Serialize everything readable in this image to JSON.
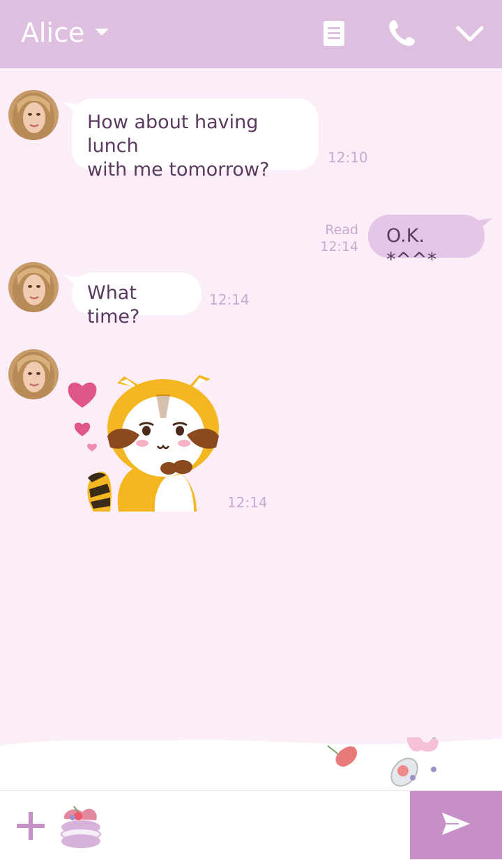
{
  "header": {
    "contact_name": "Alice",
    "icons": [
      "chevron-down-icon",
      "notes-icon",
      "phone-icon",
      "collapse-chevron-icon"
    ]
  },
  "messages": [
    {
      "from": "Alice",
      "text_line1": "How about having lunch",
      "text_line2": "with me tomorrow?",
      "time": "12:10"
    },
    {
      "from": "me",
      "text": "O.K. *^^*",
      "read_label": "Read",
      "time": "12:14"
    },
    {
      "from": "Alice",
      "text": "What time?",
      "time": "12:14"
    },
    {
      "from": "Alice",
      "type": "sticker",
      "sticker": "raccoon-hearts-sticker",
      "time": "12:14"
    }
  ],
  "input": {
    "placeholder": ""
  },
  "colors": {
    "header": "#dfbfdf",
    "chat_bg": "#fbeef8",
    "my_bubble": "#e6c6e6",
    "send_button": "#c68fc6",
    "text": "#5a3a5e",
    "time": "#c9a9cf"
  }
}
